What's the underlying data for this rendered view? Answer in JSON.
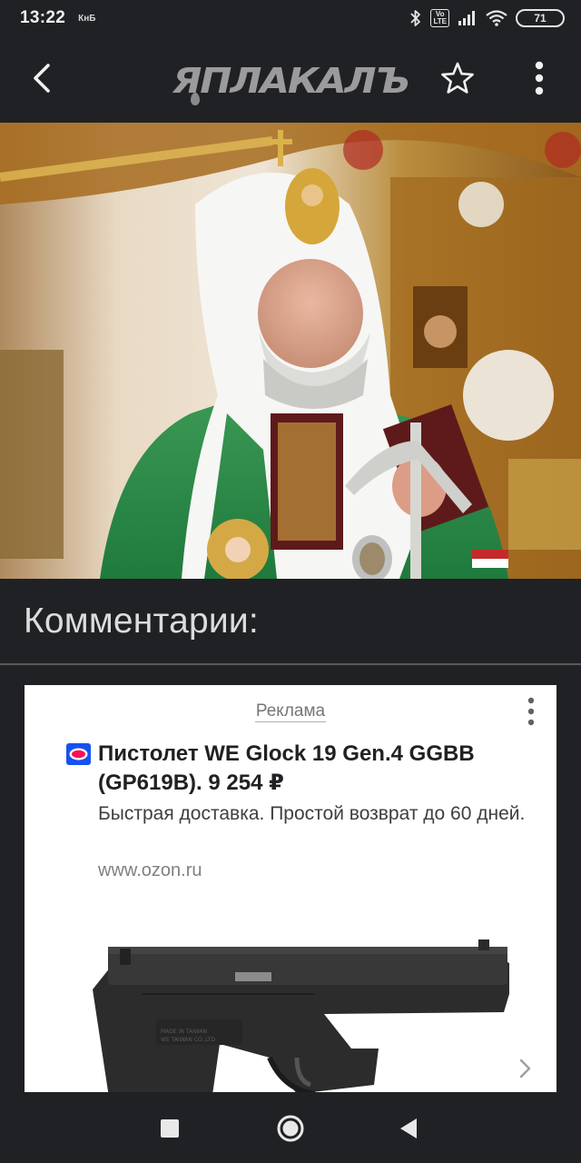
{
  "status_bar": {
    "time": "13:22",
    "carrier_label": "КнБ",
    "network_label": "Vo\nLTE",
    "battery_level": "71"
  },
  "app_bar": {
    "logo_text": "ЯПЛАКАЛЪ",
    "icons": [
      "back-arrow-icon",
      "star-icon",
      "more-vert-icon"
    ]
  },
  "hero_image": {
    "description_icon": "photo"
  },
  "comments": {
    "heading": "Комментарии:"
  },
  "ad": {
    "label": "Реклама",
    "title": "Пистолет WE Glock 19 Gen.4 GGBB (GP619B). 9 254 ₽",
    "description": "Быстрая доставка. Простой возврат до 60 дней.",
    "url": "www.ozon.ru",
    "colors": {
      "brand": "#0055ff",
      "brand_accent": "#f91155"
    }
  },
  "nav_bar": {
    "icons": [
      "recent-apps-icon",
      "home-icon",
      "back-icon"
    ]
  },
  "colors": {
    "background": "#202124",
    "card": "#ffffff",
    "logo": "#9b9b9b"
  }
}
